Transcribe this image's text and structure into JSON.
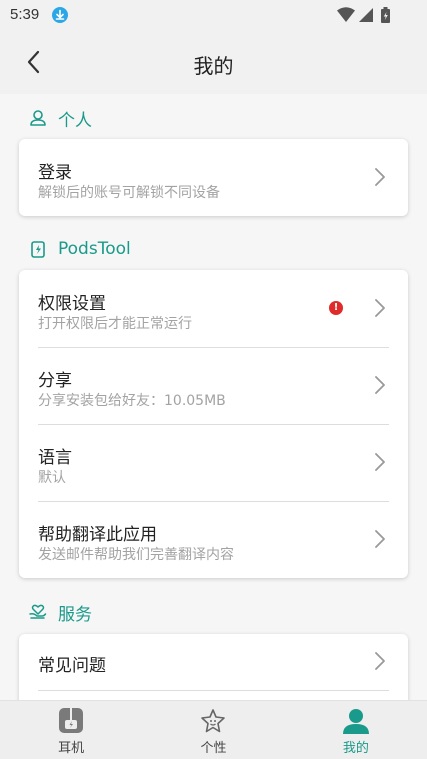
{
  "status": {
    "time": "5:39"
  },
  "header": {
    "title": "我的"
  },
  "sections": {
    "personal": {
      "title": "个人",
      "items": [
        {
          "title": "登录",
          "subtitle": "解锁后的账号可解锁不同设备"
        }
      ]
    },
    "podstool": {
      "title": "PodsTool",
      "items": [
        {
          "title": "权限设置",
          "subtitle": "打开权限后才能正常运行",
          "badge": "!"
        },
        {
          "title": "分享",
          "subtitle": "分享安装包给好友：10.05MB"
        },
        {
          "title": "语言",
          "subtitle": "默认"
        },
        {
          "title": "帮助翻译此应用",
          "subtitle": "发送邮件帮助我们完善翻译内容"
        }
      ]
    },
    "service": {
      "title": "服务",
      "items": [
        {
          "title": "常见问题"
        }
      ]
    }
  },
  "bottom_nav": {
    "items": [
      {
        "label": "耳机",
        "icon": "earbuds-icon"
      },
      {
        "label": "个性",
        "icon": "star-icon"
      },
      {
        "label": "我的",
        "icon": "person-icon",
        "active": true
      }
    ]
  },
  "colors": {
    "accent": "#1a9a8a",
    "alert": "#e02b2b",
    "download": "#2ba7e8"
  }
}
